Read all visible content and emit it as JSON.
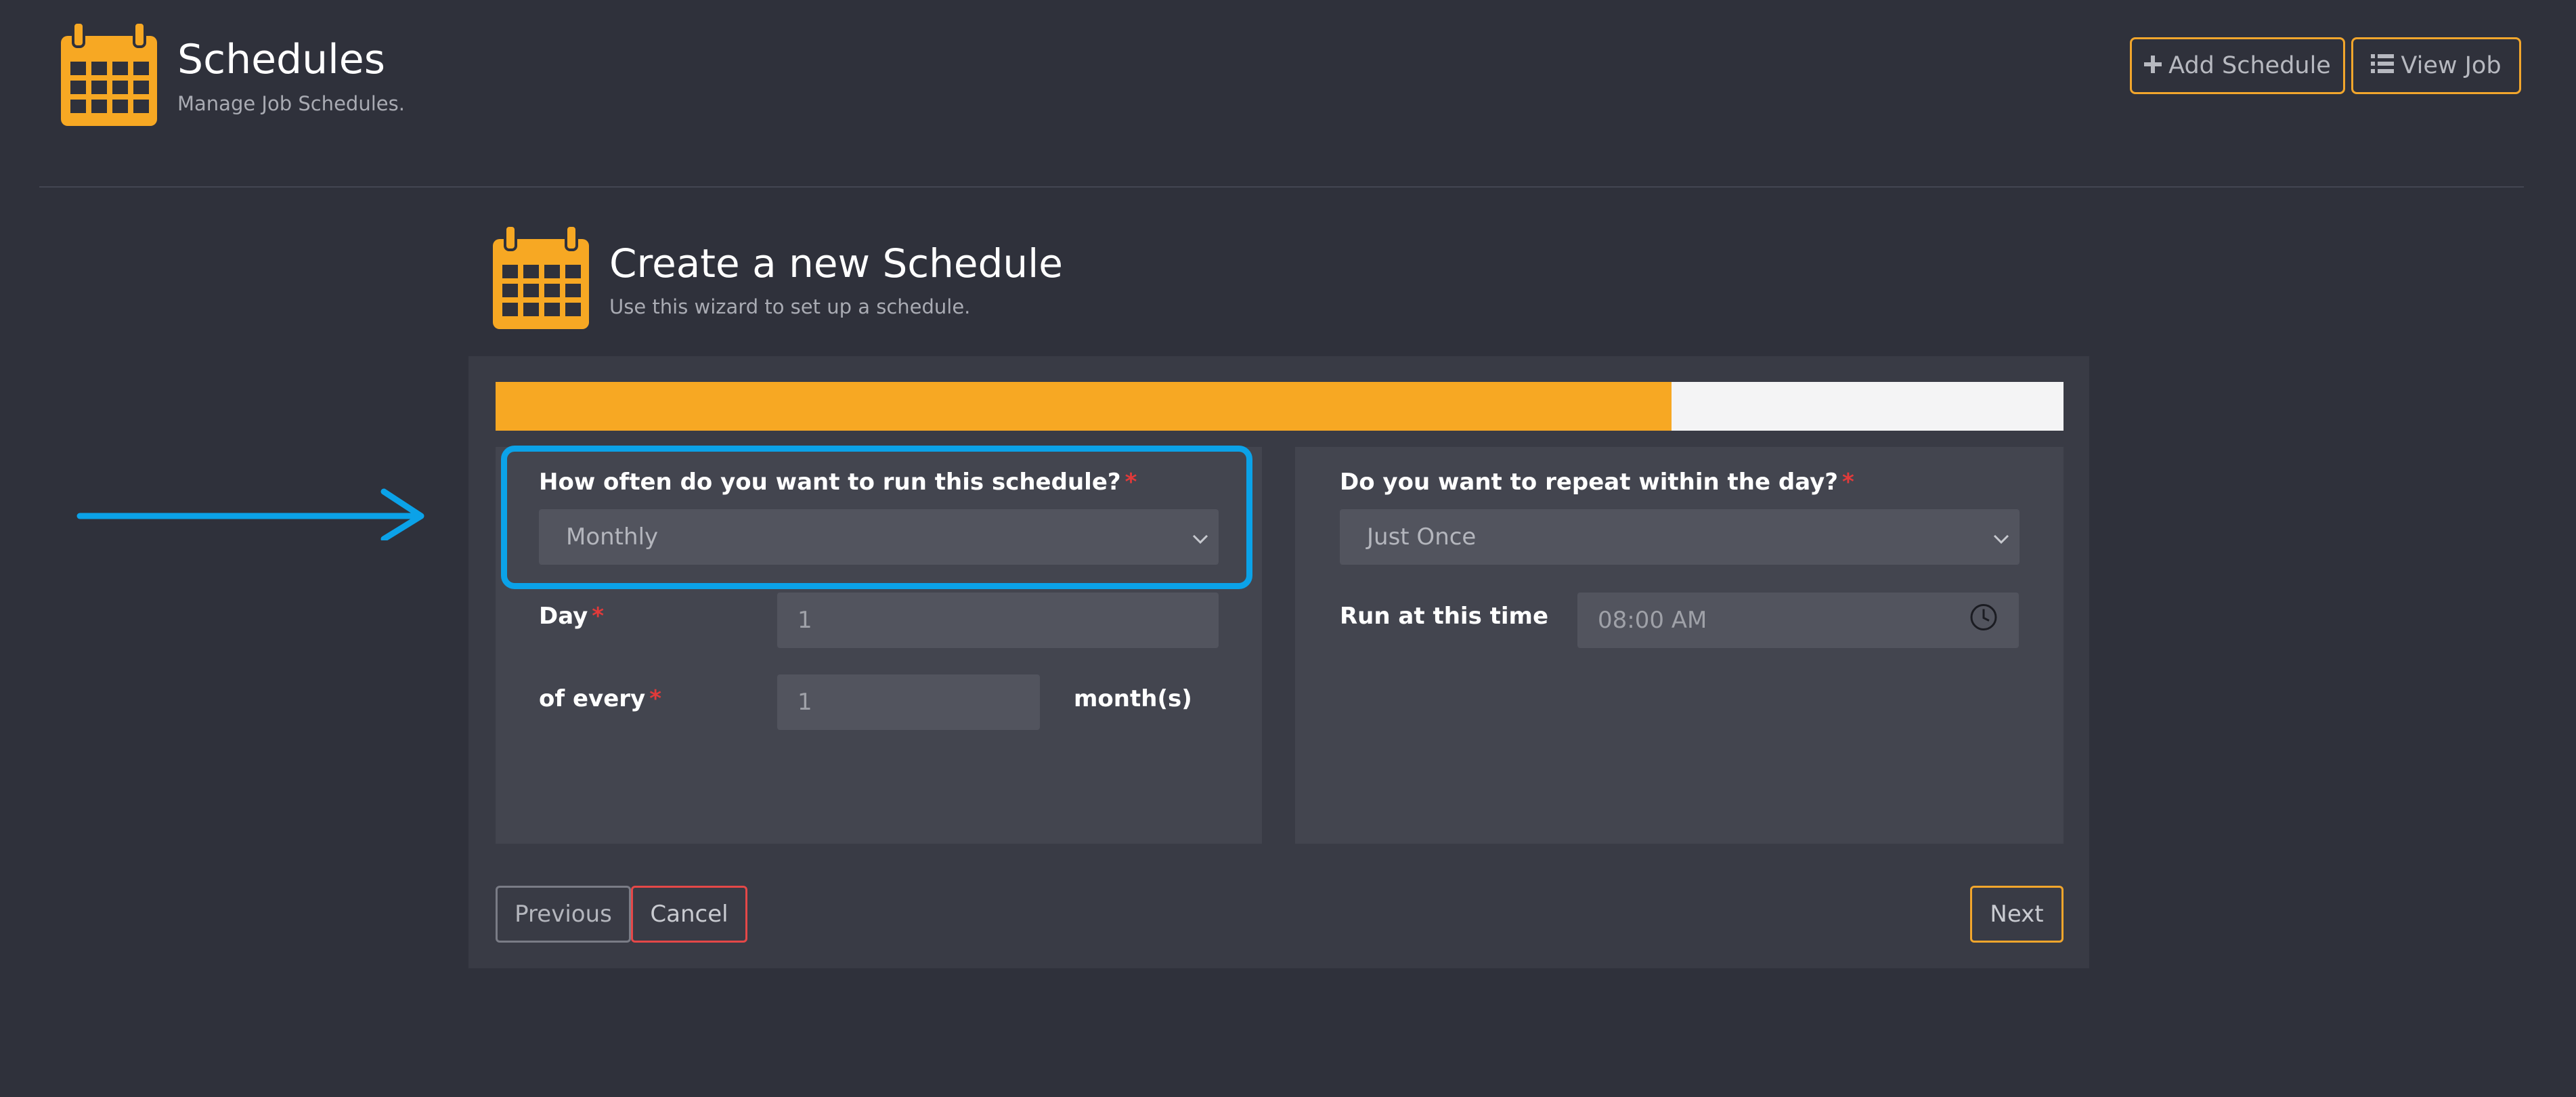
{
  "header": {
    "title": "Schedules",
    "subtitle": "Manage Job Schedules.",
    "icon": "calendar-icon",
    "accent_color": "#f7a823",
    "add_schedule_label": "Add Schedule",
    "view_job_label": "View Job"
  },
  "wizard": {
    "title": "Create a new Schedule",
    "subtitle": "Use this wizard to set up a schedule.",
    "progress_percent": 75,
    "left": {
      "frequency_label": "How often do you want to run this schedule?",
      "frequency_value": "Monthly",
      "day_label": "Day",
      "day_value": "1",
      "every_label": "of every",
      "every_value": "1",
      "every_unit": "month(s)"
    },
    "right": {
      "repeat_label": "Do you want to repeat within the day?",
      "repeat_value": "Just Once",
      "time_label": "Run at this time",
      "time_value": "08:00 AM"
    },
    "required_marker": "*",
    "previous_label": "Previous",
    "cancel_label": "Cancel",
    "next_label": "Next"
  },
  "annotation": {
    "highlight_color": "#0ba2e8"
  }
}
